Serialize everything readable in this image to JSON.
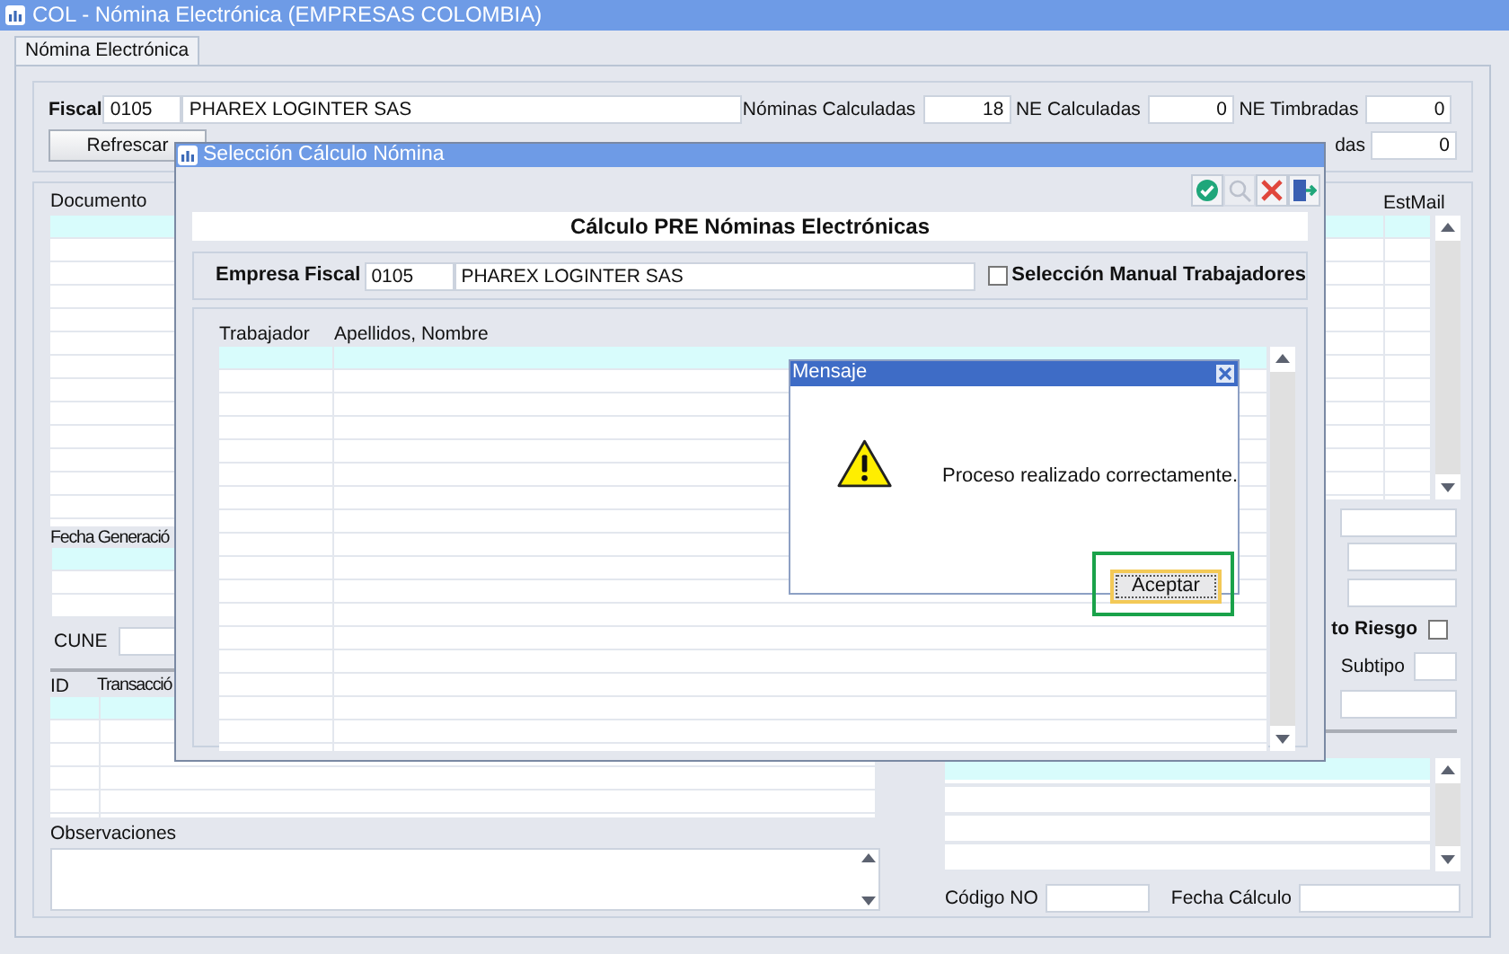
{
  "window": {
    "title": "COL - Nómina Electrónica (EMPRESAS COLOMBIA)"
  },
  "tabs": [
    {
      "label": "Nómina Electrónica",
      "selected": true
    }
  ],
  "header": {
    "fiscal_label": "Fiscal",
    "fiscal_code": "0105",
    "fiscal_name": "PHAREX LOGINTER SAS",
    "refresh_button": "Refrescar",
    "stats": [
      {
        "label": "Nóminas Calculadas",
        "value": "18"
      },
      {
        "label": "NE Calculadas",
        "value": "0"
      },
      {
        "label": "NE Timbradas",
        "value": "0"
      }
    ],
    "row2_label": "das",
    "row2_value": "0"
  },
  "left_panel": {
    "documents_column": "Documento",
    "generation_column": "Fecha Generació",
    "cune_label": "CUNE",
    "transaction_columns": [
      "ID",
      "Transacció"
    ],
    "observations_label": "Observaciones"
  },
  "right_panel": {
    "mail_column": "EstMail",
    "risk_label": "to Riesgo",
    "risk_checked": false,
    "subtype_label": "Subtipo",
    "code_label": "Código NO",
    "date_label": "Fecha Cálculo"
  },
  "dialog": {
    "title": "Selección Cálculo Nómina",
    "toolbar": [
      {
        "kind": "accept",
        "disabled": false
      },
      {
        "kind": "search",
        "disabled": true
      },
      {
        "kind": "cancel",
        "disabled": false
      },
      {
        "kind": "exit",
        "disabled": false
      }
    ],
    "heading": "Cálculo PRE Nóminas Electrónicas",
    "company_label": "Empresa Fiscal",
    "company_code": "0105",
    "company_name": "PHAREX LOGINTER SAS",
    "manual_selection": {
      "label": "Selección Manual Trabajadores",
      "checked": false
    },
    "columns": [
      "Trabajador",
      "Apellidos, Nombre"
    ]
  },
  "message": {
    "title": "Mensaje",
    "text": "Proceso realizado correctamente.",
    "button": "Aceptar",
    "button_focused": true,
    "button_highlighted": true
  }
}
